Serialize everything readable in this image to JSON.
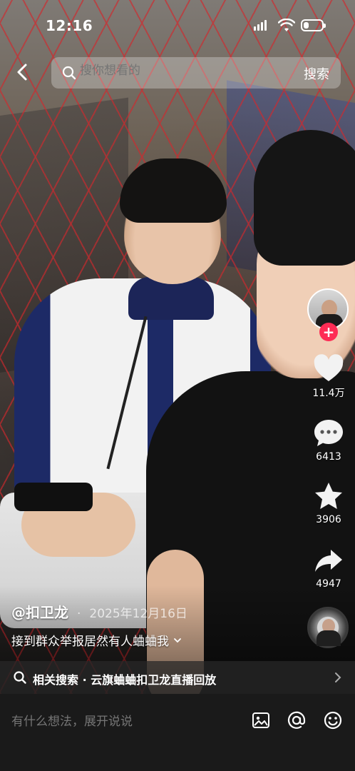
{
  "status_bar": {
    "time": "12:16",
    "battery_level": 0.3
  },
  "search": {
    "placeholder": "搜你想看的",
    "button_label": "搜索"
  },
  "actions": {
    "likes": "11.4万",
    "comments": "6413",
    "favorites": "3906",
    "shares": "4947"
  },
  "post": {
    "author": "@扣卫龙",
    "date": "2025年12月16日",
    "caption": "接到群众举报居然有人蛐蛐我",
    "date_separator": "·"
  },
  "related_search": {
    "text": "相关搜索 · 云旗蛐蛐扣卫龙直播回放"
  },
  "comment_bar": {
    "placeholder": "有什么想法，展开说说"
  },
  "colors": {
    "follow_accent": "#fe2c55",
    "bottom_bar": "#1a1a1a"
  }
}
